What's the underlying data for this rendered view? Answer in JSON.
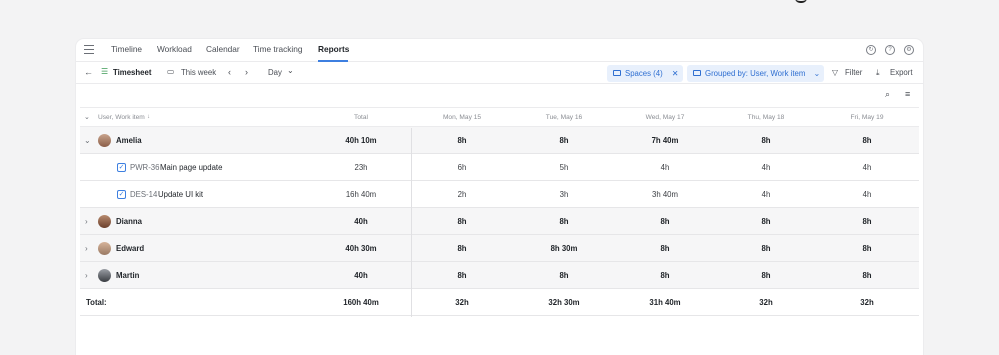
{
  "nav": {
    "tabs": [
      {
        "label": "Timeline"
      },
      {
        "label": "Workload"
      },
      {
        "label": "Calendar"
      },
      {
        "label": "Time tracking"
      },
      {
        "label": "Reports",
        "active": true
      }
    ]
  },
  "toolbar": {
    "view_label": "Timesheet",
    "period_label": "This week",
    "granularity_label": "Day",
    "spaces_chip": "Spaces (4)",
    "grouped_chip": "Grouped by: User, Work item",
    "filter_label": "Filter",
    "export_label": "Export"
  },
  "table": {
    "headers": [
      "User, Work item",
      "Total",
      "Mon, May 15",
      "Tue, May 16",
      "Wed, May 17",
      "Thu, May 18",
      "Fri, May 19"
    ],
    "rows": [
      {
        "type": "user",
        "expanded": true,
        "name": "Amelia",
        "values": [
          "40h 10m",
          "8h",
          "8h",
          "7h 40m",
          "8h",
          "8h"
        ]
      },
      {
        "type": "item",
        "code": "PWR-36",
        "title": "Main page update",
        "values": [
          "23h",
          "6h",
          "5h",
          "4h",
          "4h",
          "4h"
        ]
      },
      {
        "type": "item",
        "code": "DES-14",
        "title": "Update UI kit",
        "values": [
          "16h 40m",
          "2h",
          "3h",
          "3h 40m",
          "4h",
          "4h"
        ]
      },
      {
        "type": "user",
        "expanded": false,
        "name": "Dianna",
        "values": [
          "40h",
          "8h",
          "8h",
          "8h",
          "8h",
          "8h"
        ]
      },
      {
        "type": "user",
        "expanded": false,
        "name": "Edward",
        "values": [
          "40h 30m",
          "8h",
          "8h 30m",
          "8h",
          "8h",
          "8h"
        ]
      },
      {
        "type": "user",
        "expanded": false,
        "name": "Martin",
        "values": [
          "40h",
          "8h",
          "8h",
          "8h",
          "8h",
          "8h"
        ]
      }
    ],
    "total": {
      "label": "Total:",
      "values": [
        "160h 40m",
        "32h",
        "32h 30m",
        "31h 40m",
        "32h",
        "32h"
      ]
    }
  },
  "colors": {
    "accent": "#3d7fe0",
    "chip_bg": "#e8f0fc",
    "row_grey": "#f6f6f7"
  }
}
